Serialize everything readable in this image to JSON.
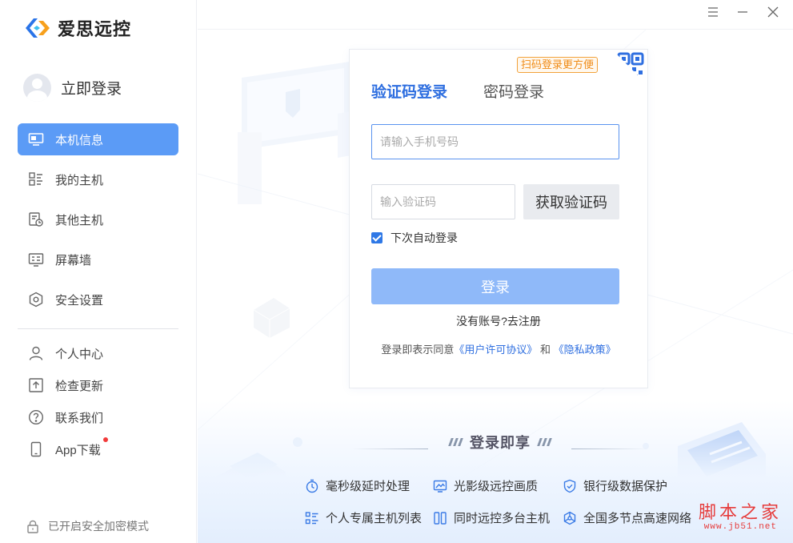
{
  "app": {
    "name": "爱思远控"
  },
  "user": {
    "login_label": "立即登录"
  },
  "sidebar": {
    "items": [
      {
        "label": "本机信息",
        "icon": "monitor-icon",
        "active": true
      },
      {
        "label": "我的主机",
        "icon": "host-list-icon",
        "active": false
      },
      {
        "label": "其他主机",
        "icon": "other-host-icon",
        "active": false
      },
      {
        "label": "屏幕墙",
        "icon": "screen-wall-icon",
        "active": false
      },
      {
        "label": "安全设置",
        "icon": "shield-hex-icon",
        "active": false
      }
    ],
    "bottom_items": [
      {
        "label": "个人中心",
        "icon": "user-icon"
      },
      {
        "label": "检查更新",
        "icon": "upload-icon"
      },
      {
        "label": "联系我们",
        "icon": "question-icon"
      },
      {
        "label": "App下载",
        "icon": "phone-icon",
        "badge": true
      }
    ],
    "secure_mode": "已开启安全加密模式"
  },
  "window_controls": {
    "menu": "menu-icon",
    "minimize": "minimize-icon",
    "close": "close-icon"
  },
  "login": {
    "qr_tip": "扫码登录更方便",
    "tabs": [
      {
        "label": "验证码登录",
        "active": true
      },
      {
        "label": "密码登录",
        "active": false
      }
    ],
    "phone_placeholder": "请输入手机号码",
    "phone_value": "",
    "code_placeholder": "输入验证码",
    "code_value": "",
    "get_code_label": "获取验证码",
    "auto_login_label": "下次自动登录",
    "auto_login_checked": true,
    "login_button": "登录",
    "no_account": "没有账号?",
    "register": "去注册",
    "agreement_prefix": "登录即表示同意",
    "user_agreement": "《用户许可协议》",
    "agreement_and": "和",
    "privacy_policy": "《隐私政策》"
  },
  "benefits": {
    "title": "登录即享",
    "features": [
      {
        "label": "毫秒级延时处理",
        "icon": "stopwatch-icon"
      },
      {
        "label": "光影级远控画质",
        "icon": "image-monitor-icon"
      },
      {
        "label": "银行级数据保护",
        "icon": "shield-check-icon"
      },
      {
        "label": "个人专属主机列表",
        "icon": "list-icon"
      },
      {
        "label": "同时远控多台主机",
        "icon": "dual-device-icon"
      },
      {
        "label": "全国多节点高速网络",
        "icon": "network-icon"
      }
    ]
  },
  "watermark": {
    "main": "脚本之家",
    "sub": "www.jb51.net"
  },
  "colors": {
    "accent": "#5b9bf6",
    "link": "#2f6fe0",
    "qr_tip": "#f08c18",
    "login_button": "#8fb9f9"
  }
}
